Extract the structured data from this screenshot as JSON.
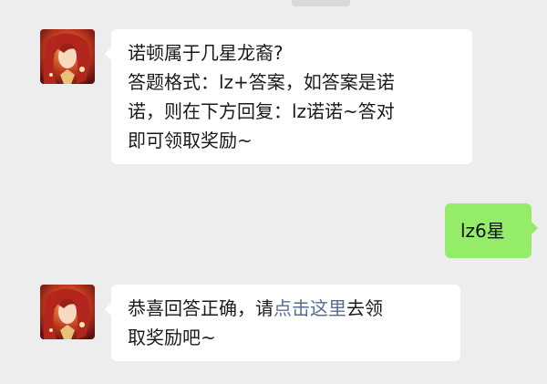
{
  "chat": {
    "messages": [
      {
        "sender": "other",
        "avatar_icon": "character-avatar-icon",
        "lines": [
          "诺顿属于几星龙裔?",
          "答题格式：lz+答案，如答案是诺",
          "诺，则在下方回复：lz诺诺~答对",
          "即可领取奖励~"
        ]
      },
      {
        "sender": "self",
        "text": "lz6星"
      },
      {
        "sender": "other",
        "avatar_icon": "character-avatar-icon",
        "line1_before": "恭喜回答正确，请",
        "line1_link": "点击这里",
        "line1_after": "去领",
        "line2": "取奖励吧~"
      }
    ]
  },
  "colors": {
    "background": "#ededed",
    "bubble_incoming": "#ffffff",
    "bubble_outgoing": "#95ec69",
    "link": "#576b95"
  }
}
